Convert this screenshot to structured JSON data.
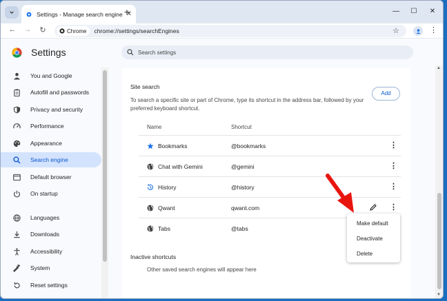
{
  "window": {
    "tab_title": "Settings - Manage search engine",
    "url_chip": "Chrome",
    "url": "chrome://settings/searchEngines"
  },
  "header": {
    "title": "Settings",
    "search_placeholder": "Search settings"
  },
  "sidebar": {
    "items": [
      {
        "label": "You and Google",
        "icon": "person-icon"
      },
      {
        "label": "Autofill and passwords",
        "icon": "clipboard-icon"
      },
      {
        "label": "Privacy and security",
        "icon": "shield-icon"
      },
      {
        "label": "Performance",
        "icon": "speedometer-icon"
      },
      {
        "label": "Appearance",
        "icon": "palette-icon"
      },
      {
        "label": "Search engine",
        "icon": "search-icon",
        "active": true
      },
      {
        "label": "Default browser",
        "icon": "browser-icon"
      },
      {
        "label": "On startup",
        "icon": "power-icon"
      },
      {
        "label": "Languages",
        "icon": "globe-icon"
      },
      {
        "label": "Downloads",
        "icon": "download-icon"
      },
      {
        "label": "Accessibility",
        "icon": "accessibility-icon"
      },
      {
        "label": "System",
        "icon": "wrench-icon"
      },
      {
        "label": "Reset settings",
        "icon": "reset-icon"
      }
    ]
  },
  "site_search": {
    "title": "Site search",
    "description": "To search a specific site or part of Chrome, type its shortcut in the address bar, followed by your preferred keyboard shortcut.",
    "add_label": "Add",
    "columns": {
      "name": "Name",
      "shortcut": "Shortcut"
    },
    "rows": [
      {
        "name": "Bookmarks",
        "shortcut": "@bookmarks",
        "icon": "star-icon"
      },
      {
        "name": "Chat with Gemini",
        "shortcut": "@gemini",
        "icon": "globe-icon"
      },
      {
        "name": "History",
        "shortcut": "@history",
        "icon": "history-icon"
      },
      {
        "name": "Qwant",
        "shortcut": "qwant.com",
        "icon": "globe-icon"
      },
      {
        "name": "Tabs",
        "shortcut": "@tabs",
        "icon": "globe-icon"
      }
    ]
  },
  "inactive": {
    "title": "Inactive shortcuts",
    "description": "Other saved search engines will appear here"
  },
  "menu": {
    "items": [
      "Make default",
      "Deactivate",
      "Delete"
    ]
  },
  "colors": {
    "accent": "#0b57d0",
    "active_bg": "#d3e3fd",
    "annotation": "#e8150f"
  }
}
